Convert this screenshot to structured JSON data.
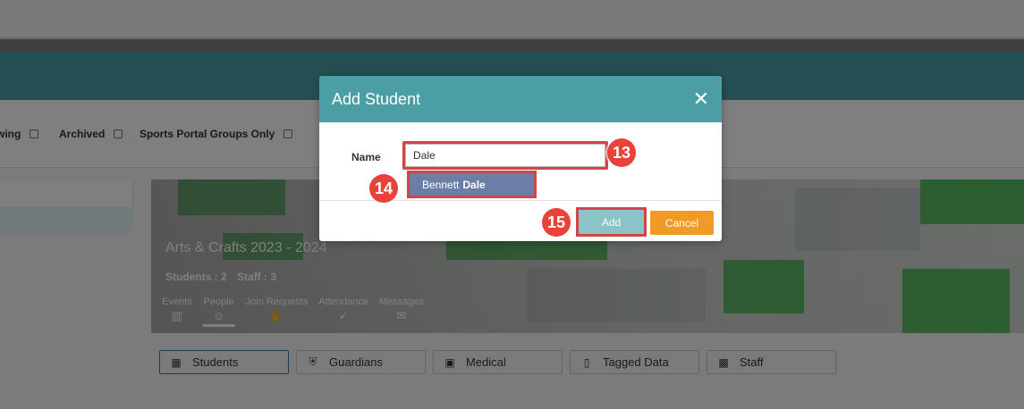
{
  "filters": {
    "showing_partial": "wing",
    "archived": "Archived",
    "sports_only": "Sports Portal Groups Only"
  },
  "group": {
    "title": "Arts & Crafts 2023 - 2024",
    "students": "Students : 2",
    "staff": "Staff : 3",
    "tabs": [
      {
        "label": "Events",
        "icon": "calendar-icon"
      },
      {
        "label": "People",
        "icon": "person-icon"
      },
      {
        "label": "Join Requests",
        "icon": "hand-icon"
      },
      {
        "label": "Attendance",
        "icon": "clipboard-check-icon"
      },
      {
        "label": "Messages",
        "icon": "envelope-icon"
      }
    ]
  },
  "subtabs": [
    {
      "label": "Students",
      "icon": "students-icon"
    },
    {
      "label": "Guardians",
      "icon": "shield-icon"
    },
    {
      "label": "Medical",
      "icon": "medical-icon"
    },
    {
      "label": "Tagged Data",
      "icon": "tag-icon"
    },
    {
      "label": "Staff",
      "icon": "staff-icon"
    }
  ],
  "modal": {
    "title": "Add Student",
    "name_label": "Name",
    "name_value": "Dale",
    "suggestion_first": "Bennett",
    "suggestion_bold": "Dale",
    "add_label": "Add",
    "cancel_label": "Cancel"
  },
  "steps": {
    "input": "13",
    "suggestion": "14",
    "add": "15"
  },
  "colors": {
    "accent": "#4a9ea4",
    "cancel": "#f29a26",
    "highlight": "#d0454a",
    "step": "#e8423b"
  }
}
